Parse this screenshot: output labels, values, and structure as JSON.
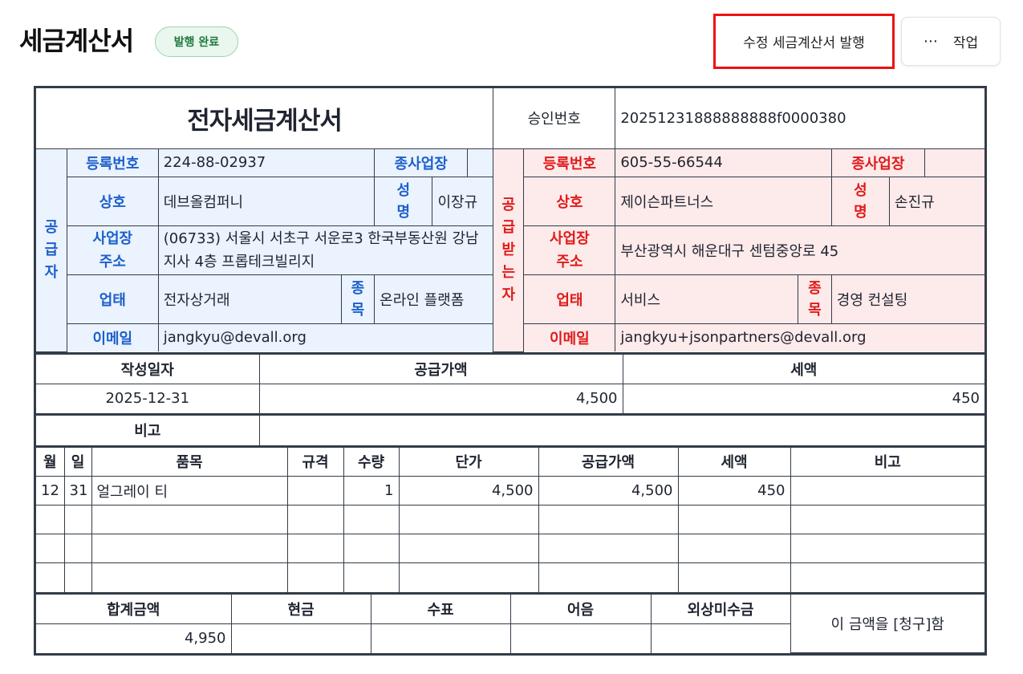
{
  "header": {
    "title": "세금계산서",
    "status": "발행 완료",
    "revise_button": "수정 세금계산서 발행",
    "more_icon": "⋯",
    "actions_button": "작업"
  },
  "invoice": {
    "doc_title": "전자세금계산서",
    "approval_label": "승인번호",
    "approval_number": "20251231888888888f0000380",
    "labels": {
      "reg_no": "등록번호",
      "sub_biz": "종사업장",
      "company": "상호",
      "name_1": "성",
      "name_2": "명",
      "address_1": "사업장",
      "address_2": "주소",
      "biz_type": "업태",
      "item_1": "종",
      "item_2": "목",
      "email": "이메일"
    },
    "supplier": {
      "side_label": [
        "공",
        "급",
        "자"
      ],
      "reg_no": "224-88-02937",
      "sub_biz": "",
      "company": "데브올컴퍼니",
      "rep_name": "이장규",
      "address_line1": "(06733) 서울시 서초구 서운로3 한국부동산원 강남",
      "address_line2": "지사 4층 프롭테크빌리지",
      "biz_type": "전자상거래",
      "biz_item": "온라인 플랫폼",
      "email": "jangkyu@devall.org"
    },
    "receiver": {
      "side_label": [
        "공",
        "급",
        "받",
        "는",
        "자"
      ],
      "reg_no": "605-55-66544",
      "sub_biz": "",
      "company": "제이슨파트너스",
      "rep_name": "손진규",
      "address": "부산광역시 해운대구 센텀중앙로 45",
      "biz_type": "서비스",
      "biz_item": "경영 컨설팅",
      "email": "jangkyu+jsonpartners@devall.org"
    },
    "summary": {
      "date_label": "작성일자",
      "supply_label": "공급가액",
      "tax_label": "세액",
      "date": "2025-12-31",
      "supply_amount": "4,500",
      "tax_amount": "450",
      "note_label": "비고",
      "note": ""
    },
    "items": {
      "headers": [
        "월",
        "일",
        "품목",
        "규격",
        "수량",
        "단가",
        "공급가액",
        "세액",
        "비고"
      ],
      "rows": [
        [
          "12",
          "31",
          "얼그레이 티",
          "",
          "1",
          "4,500",
          "4,500",
          "450",
          ""
        ],
        [
          "",
          "",
          "",
          "",
          "",
          "",
          "",
          "",
          ""
        ],
        [
          "",
          "",
          "",
          "",
          "",
          "",
          "",
          "",
          ""
        ],
        [
          "",
          "",
          "",
          "",
          "",
          "",
          "",
          "",
          ""
        ]
      ]
    },
    "totals": {
      "headers": [
        "합계금액",
        "현금",
        "수표",
        "어음",
        "외상미수금"
      ],
      "values": [
        "4,950",
        "",
        "",
        "",
        ""
      ],
      "claim_text": "이 금액을 [청구]함"
    }
  }
}
